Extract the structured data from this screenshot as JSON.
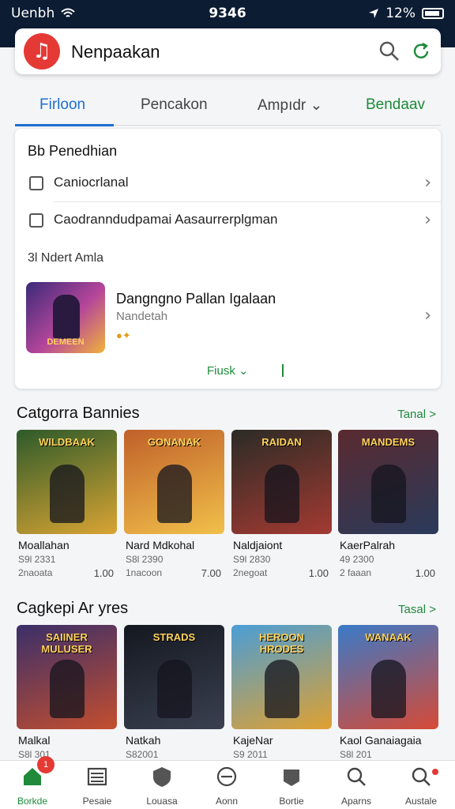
{
  "status_bar": {
    "carrier": "Uenbh",
    "time": "9346",
    "battery": "12%"
  },
  "app": {
    "title": "Nenpaakan",
    "logo_icon": "music-note-icon"
  },
  "tabs": [
    {
      "label": "Firloon",
      "active": true
    },
    {
      "label": "Pencakon"
    },
    {
      "label": "Ampıdr ⌄"
    },
    {
      "label": "Bendaav"
    }
  ],
  "filter_card": {
    "heading": "Bb Penedhian",
    "rows": [
      {
        "label": "Caniocrlanal"
      },
      {
        "label": "Caodranndudpamai Aasaurrerplgman"
      }
    ],
    "subheading": "3l Ndert Amla",
    "featured": {
      "title": "Dangngno Pallan Igalaan",
      "subtitle": "Nandetah",
      "thumb_caption": "DEMEEN"
    },
    "more_label": "Fiusk ⌄"
  },
  "section1": {
    "title": "Catgorra Bannies",
    "link": "Tanal >",
    "games": [
      {
        "name": "Moallahan",
        "meta1": "S9l 2331",
        "meta2": "2naoata",
        "price": "1.00",
        "thumb": "WILDBAAK",
        "colors": [
          "#2d5a2a",
          "#d9a433"
        ]
      },
      {
        "name": "Nard Mdkohal",
        "meta1": "S8l 2390",
        "meta2": "1nacoon",
        "price": "7.00",
        "thumb": "GONANAK",
        "colors": [
          "#c0602a",
          "#f1c04a"
        ]
      },
      {
        "name": "Naldjaiont",
        "meta1": "S9l 2830",
        "meta2": "2negoat",
        "price": "1.00",
        "thumb": "RAIDAN",
        "colors": [
          "#2b2b26",
          "#a33a32"
        ]
      },
      {
        "name": "KaerPalrah",
        "meta1": "49 2300",
        "meta2": "2 faaan",
        "price": "1.00",
        "thumb": "MANDEMS",
        "colors": [
          "#5a2a30",
          "#2a3a5a"
        ]
      }
    ]
  },
  "section2": {
    "title": "Cagkepi Ar yres",
    "link": "Tasal >",
    "games": [
      {
        "name": "Malkal",
        "meta1": "S8l 301",
        "thumb": "SAIINER MULUSER",
        "colors": [
          "#3a2f6a",
          "#c44e2e"
        ]
      },
      {
        "name": "Natkah",
        "meta1": "S82001",
        "thumb": "STRADS",
        "colors": [
          "#141820",
          "#3a4050"
        ]
      },
      {
        "name": "KajeNar",
        "meta1": "S9 2011",
        "thumb": "HEROON HRODES",
        "colors": [
          "#4a9ed6",
          "#e0a030"
        ]
      },
      {
        "name": "Kaol Ganaiagaia",
        "meta1": "S8l 201",
        "thumb": "WANAAK",
        "colors": [
          "#3a7ac8",
          "#d64a36"
        ]
      }
    ]
  },
  "bottom_nav": [
    {
      "label": "Borkde",
      "icon": "home-icon",
      "badge": "1",
      "active": true
    },
    {
      "label": "Pesaie",
      "icon": "list-icon"
    },
    {
      "label": "Louasa",
      "icon": "shield-icon"
    },
    {
      "label": "Aonn",
      "icon": "compass-icon"
    },
    {
      "label": "Bortie",
      "icon": "map-icon"
    },
    {
      "label": "Aparns",
      "icon": "search-icon"
    },
    {
      "label": "Austale",
      "icon": "search-alt-icon"
    }
  ]
}
